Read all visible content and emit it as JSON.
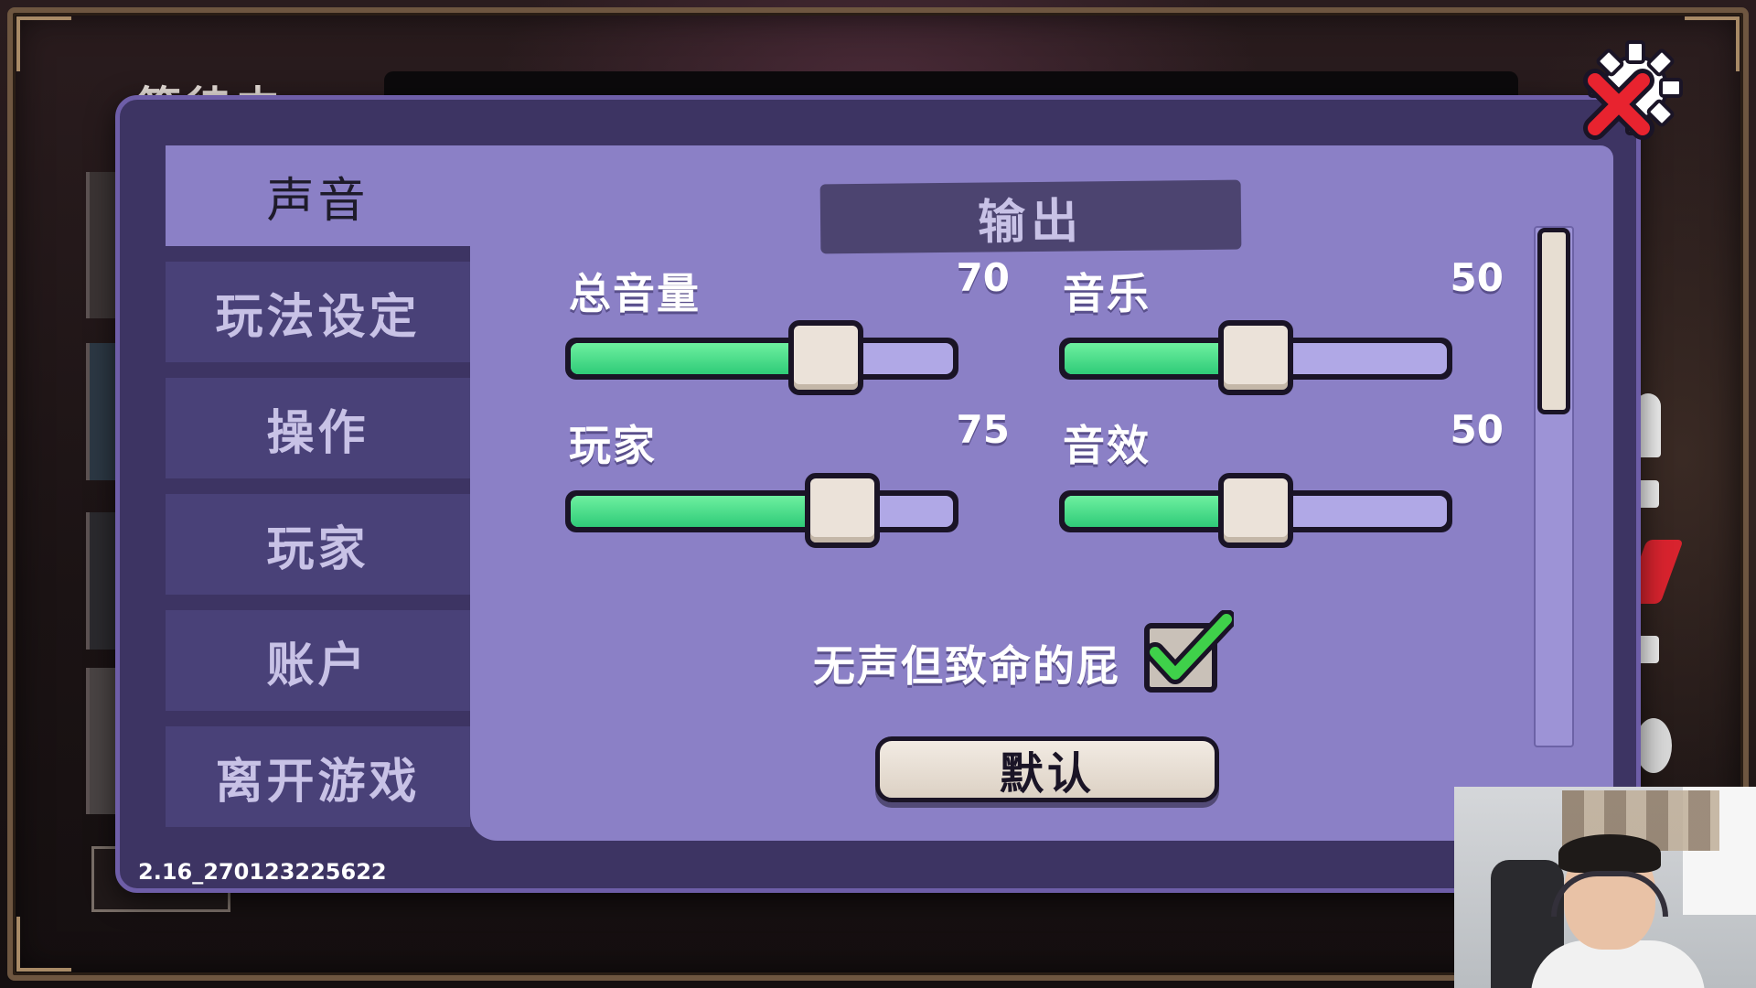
{
  "background": {
    "title": "等待中"
  },
  "tabs": [
    {
      "label": "声音",
      "active": true
    },
    {
      "label": "玩法设定",
      "active": false
    },
    {
      "label": "操作",
      "active": false
    },
    {
      "label": "玩家",
      "active": false
    },
    {
      "label": "账户",
      "active": false
    },
    {
      "label": "离开游戏",
      "active": false
    }
  ],
  "section": {
    "title": "输出"
  },
  "sliders": {
    "master": {
      "label": "总音量",
      "value": "70",
      "percent": 70
    },
    "music": {
      "label": "音乐",
      "value": "50",
      "percent": 50
    },
    "player": {
      "label": "玩家",
      "value": "75",
      "percent": 75
    },
    "sfx": {
      "label": "音效",
      "value": "50",
      "percent": 50
    }
  },
  "toggle": {
    "label": "无声但致命的屁",
    "checked": true
  },
  "buttons": {
    "default_label": "默认"
  },
  "version": "2.16_270123225622",
  "colors": {
    "panel_bg": "#3d3463",
    "content_bg": "#8b80c6",
    "tab_bg": "#494178",
    "slider_fill": "#2fcb78",
    "close_red": "#e8232f"
  },
  "icons": {
    "close": "gear-close-icon",
    "check": "checkmark-icon"
  }
}
